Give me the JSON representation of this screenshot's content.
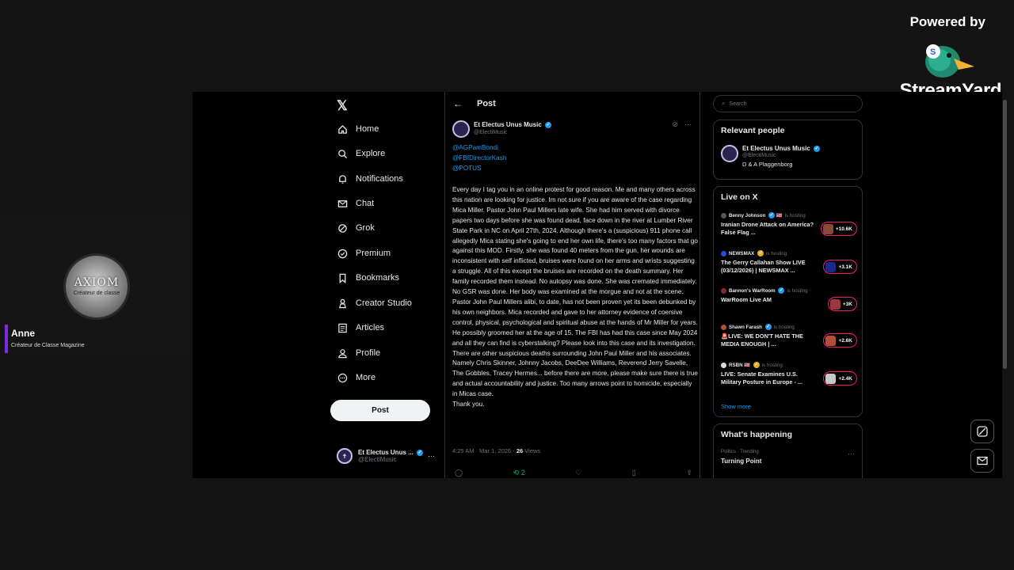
{
  "branding": {
    "powered_by": "Powered by",
    "name": "StreamYard"
  },
  "presenter": {
    "avatar_title": "AXIOM",
    "avatar_subtitle": "Créateur de classe",
    "name": "Anne",
    "subtitle": "Créateur de Classe Magazine",
    "accent_color": "#7b2be2"
  },
  "x_nav": {
    "items": [
      {
        "label": "Home",
        "icon": "home-icon"
      },
      {
        "label": "Explore",
        "icon": "search-icon"
      },
      {
        "label": "Notifications",
        "icon": "bell-icon"
      },
      {
        "label": "Chat",
        "icon": "mail-icon"
      },
      {
        "label": "Grok",
        "icon": "grok-icon"
      },
      {
        "label": "Premium",
        "icon": "premium-icon"
      },
      {
        "label": "Bookmarks",
        "icon": "bookmark-icon"
      },
      {
        "label": "Creator Studio",
        "icon": "creator-icon"
      },
      {
        "label": "Articles",
        "icon": "articles-icon"
      },
      {
        "label": "Profile",
        "icon": "profile-icon"
      },
      {
        "label": "More",
        "icon": "more-icon"
      }
    ],
    "post_button": "Post",
    "account": {
      "name": "Et Electus Unus ...",
      "handle": "@ElectiMusic"
    }
  },
  "post": {
    "header": "Post",
    "author": {
      "name": "Et Electus Unus Music",
      "handle": "@ElectiMusic"
    },
    "mentions": [
      "@AGPamBondi",
      "@FBIDirectorKash",
      "@POTUS"
    ],
    "body": "Every day I tag you in an online protest for good reason. Me and many others across this nation are looking for justice. Im not sure if you are aware of the case regarding Mica Miller. Pastor John Paul Millers late wife. She had him served with divorce papers two days before she was found dead, face down in the river at Lumber River State Park in NC on April 27th, 2024. Although there's a (suspicious) 911 phone call allegedly Mica stating she's going to end her own life, there's too many factors that go against this MOD. Firstly, she was found 40 meters from the gun, her wounds are inconsistent with self inflicted, bruises were found on her arms and wrists suggesting a struggle. All of this except the bruises are recorded on the death summary. Her family recorded them instead. No autopsy was done. She was cremated immediately. No GSR was done. Her body was examined at the morgue and not at the scene. Pastor John Paul Millers alibi, to date, has not been proven yet its been debunked by his own neighbors. Mica recorded and gave to her attorney evidence of coersive control, physical, psychological and spiritual abuse at the hands of Mr Miller for years. He possibly groomed her at the age of 15. The FBI has had this case since May 2024 and all they can find is cyberstalking? Please look into this case and its investigation. There are other suspicious deaths surrounding John Paul Miller and his associates. Namely Chris Skinner, Johnny Jacobs, DeeDee Williams, Reverend Jerry Savelle, The Gobbles, Tracey Hermes... before there are more, please make sure there is true and actual accountability and justice. Too many arrows point to homicide, especially in Micas case.",
    "closing": "Thank you.",
    "time": "4:25 AM · Mar 1, 2026 · ",
    "views_count": "26",
    "views_label": " Views",
    "repost_count": "2"
  },
  "sidebar": {
    "search_placeholder": "Search",
    "relevant_title": "Relevant people",
    "relevant": {
      "name": "Et Electus Unus Music",
      "handle": "@ElectiMusic",
      "bio": "D & A Plaggenborg"
    },
    "live_title": "Live on X",
    "live": [
      {
        "host": "Benny Johnson",
        "flag": "🇺🇸",
        "hosting": "is hosting",
        "title": "Iranian Drone Attack on America? False Flag ...",
        "count": "+10.6K",
        "thumb_color": "#8a4a3a"
      },
      {
        "host": "NEWSMAX",
        "flag": "",
        "hosting": "is hosting",
        "title": "The Gerry Callahan Show LIVE (03/12/2026) | NEWSMAX ...",
        "count": "+3.1K",
        "thumb_color": "#1a2a8a"
      },
      {
        "host": "Bannon's WarRoom",
        "flag": "",
        "hosting": "is hosting",
        "title": "WarRoom Live AM",
        "count": "+3K",
        "thumb_color": "#9a3a3a"
      },
      {
        "host": "Shawn Farash",
        "flag": "",
        "hosting": "is hosting",
        "title": "🚨LIVE: WE DON'T HATE THE MEDIA ENOUGH | ...",
        "count": "+2.6K",
        "thumb_color": "#b0503a"
      },
      {
        "host": "RSBN",
        "flag": "🇺🇸",
        "hosting": "is hosting",
        "title": "LIVE: Senate Examines U.S. Military Posture in Europe - ...",
        "count": "+2.4K",
        "thumb_color": "#c8c8c8"
      }
    ],
    "show_more": "Show more",
    "happening_title": "What's happening",
    "trend_category": "Politics · Trending",
    "trend_topic": "Turning Point"
  }
}
